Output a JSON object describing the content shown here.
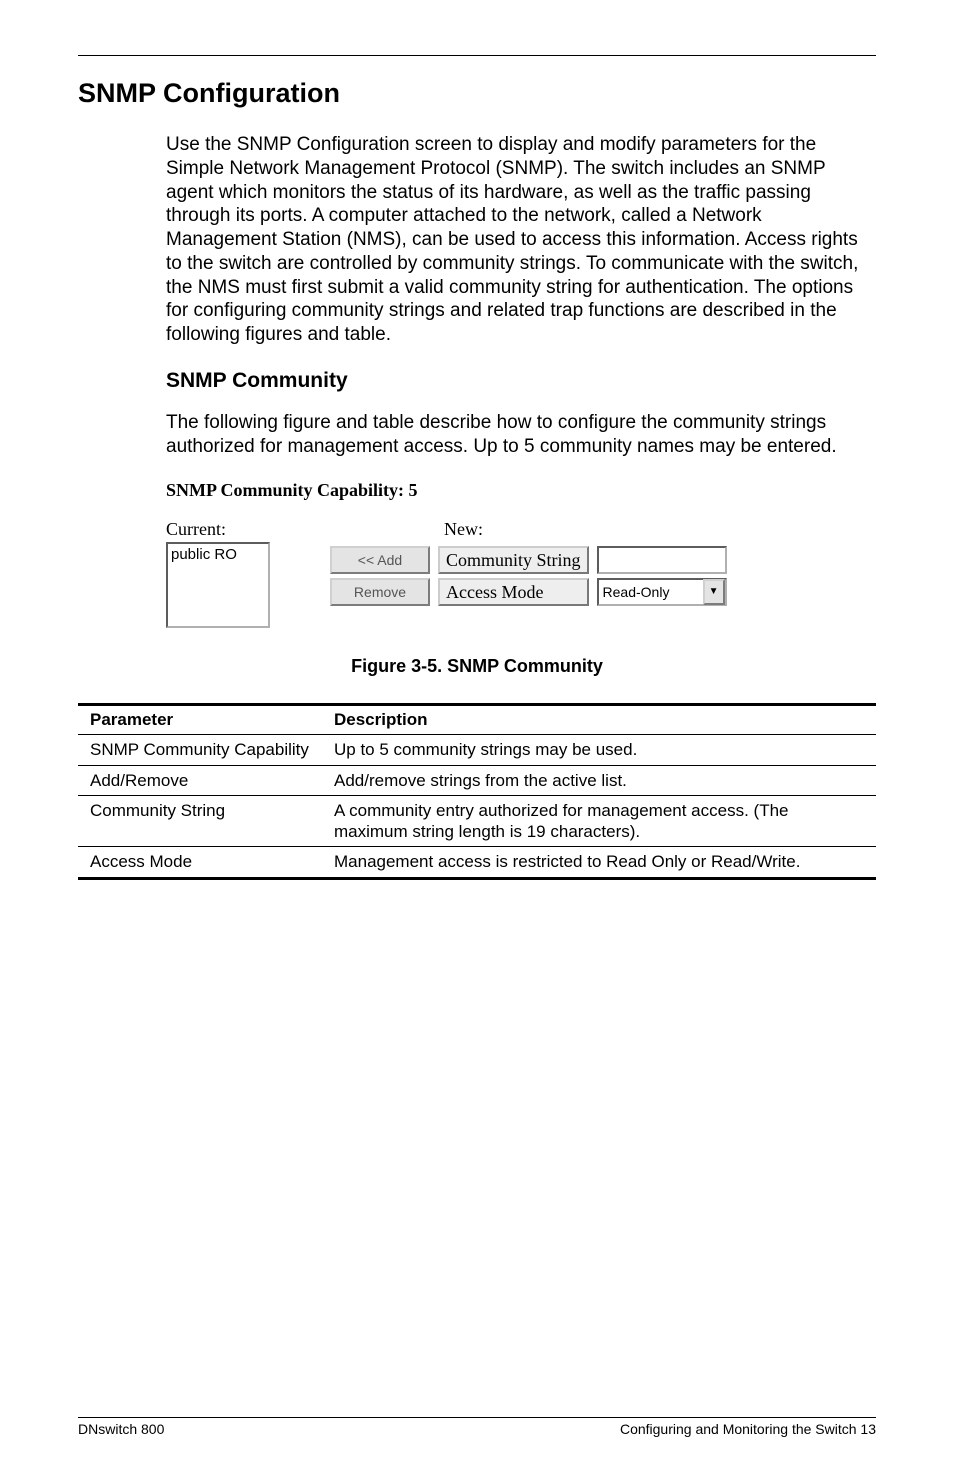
{
  "heading": "SNMP Configuration",
  "intro": "Use the SNMP Configuration screen to display and modify parameters for the Simple Network Management Protocol (SNMP). The switch includes an SNMP agent which monitors the status of its hardware, as well as the traffic passing through its ports. A computer attached to the network, called a Network Management Station (NMS), can be used to access this information. Access rights to the switch are controlled by community strings. To communicate with the switch, the NMS must first submit a valid community string for authentication. The options for configuring community strings and related trap functions are described in the following figures and table.",
  "subsection": "SNMP Community",
  "sub_intro": "The following figure and table describe how to configure the community strings authorized for management access. Up to 5 community names may be entered.",
  "capability_label": "SNMP Community Capability: 5",
  "widget": {
    "current_label": "Current:",
    "new_label": "New:",
    "list_items": [
      "public RO"
    ],
    "add_label": "<< Add",
    "remove_label": "Remove",
    "community_label": "Community String",
    "access_label": "Access Mode",
    "access_selected": "Read-Only"
  },
  "figure_caption": "Figure 3-5.  SNMP Community",
  "table": {
    "headers": [
      "Parameter",
      "Description"
    ],
    "rows": [
      {
        "param": "SNMP Community Capability",
        "desc": "Up to 5 community strings may be used."
      },
      {
        "param": "Add/Remove",
        "desc": "Add/remove strings from the active list."
      },
      {
        "param": "Community String",
        "desc": "A community entry authorized for management access. (The maximum string length is 19 characters)."
      },
      {
        "param": "Access Mode",
        "desc": "Management access is restricted to Read Only or Read/Write."
      }
    ]
  },
  "footer": {
    "left": "DNswitch 800",
    "right": "Configuring and Monitoring the Switch  13"
  }
}
